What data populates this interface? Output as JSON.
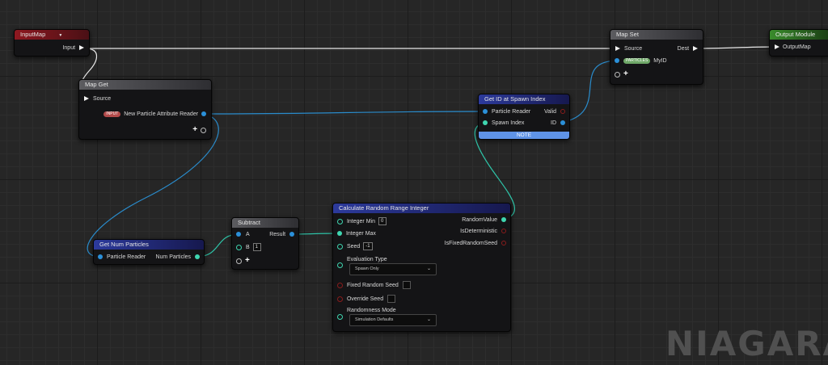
{
  "nodes": {
    "input_map": {
      "title": "InputMap",
      "dropdown_glyph": "▼",
      "output": "Input"
    },
    "map_get": {
      "title": "Map Get",
      "source": "Source",
      "tag": "INPUT",
      "output": "New Particle Attribute Reader",
      "add_glyph": "+"
    },
    "map_set": {
      "title": "Map Set",
      "source": "Source",
      "dest": "Dest",
      "tag": "PARTICLES",
      "myid": "MyID",
      "add_glyph": "+"
    },
    "output_module": {
      "title": "Output Module",
      "pin": "OutputMap"
    },
    "get_id": {
      "title": "Get ID at Spawn Index",
      "in1": "Particle Reader",
      "out1": "Valid",
      "in2": "Spawn Index",
      "out2": "ID",
      "note": "NOTE"
    },
    "get_num": {
      "title": "Get Num Particles",
      "input": "Particle Reader",
      "output": "Num Particles"
    },
    "subtract": {
      "title": "Subtract",
      "a": "A",
      "b": "B",
      "b_value": "1",
      "result": "Result",
      "add_glyph": "+"
    },
    "calc_random": {
      "title": "Calculate Random Range Integer",
      "int_min": "Integer Min",
      "int_min_value": "0",
      "int_max": "Integer Max",
      "seed": "Seed",
      "seed_value": "-1",
      "out_random": "RandomValue",
      "out_det": "IsDeterministic",
      "out_fixed": "IsFixedRandomSeed",
      "eval_label": "Evaluation Type",
      "eval_value": "Spawn Only",
      "fixed_seed": "Fixed Random Seed",
      "override_seed": "Override Seed",
      "rand_mode_label": "Randomness Mode",
      "rand_mode_value": "Simulation Defaults",
      "dd_arrow": "⌄"
    }
  },
  "watermark": "NIAGARA",
  "colors": {
    "exec_pin": "#f2f2f2",
    "attribute_reader_pin": "#2b90d9",
    "integer_pin": "#3fd6b0",
    "bool_pin": "#8a1c1c",
    "wire_exec": "#e8e8e8",
    "wire_reader": "#2a8ccc",
    "wire_int": "#2ec4a8"
  }
}
